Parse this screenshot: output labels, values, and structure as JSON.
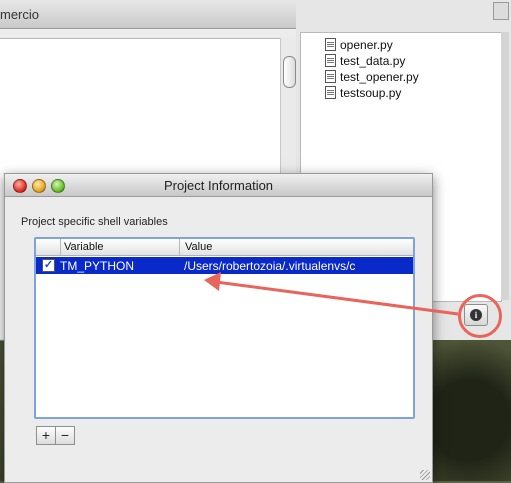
{
  "back_window": {
    "title": "mercio"
  },
  "file_window": {
    "files": [
      "opener.py",
      "test_data.py",
      "test_opener.py",
      "testsoup.py"
    ],
    "info_button_icon": "i"
  },
  "dialog": {
    "title": "Project Information",
    "section_label": "Project specific shell variables",
    "columns": {
      "variable": "Variable",
      "value": "Value"
    },
    "rows": [
      {
        "enabled": true,
        "variable": "TM_PYTHON",
        "value": "/Users/robertozoia/.virtualenvs/c"
      }
    ],
    "add_label": "+",
    "remove_label": "−"
  },
  "colors": {
    "selection": "#0a29c9",
    "annotation": "#e9645a"
  }
}
